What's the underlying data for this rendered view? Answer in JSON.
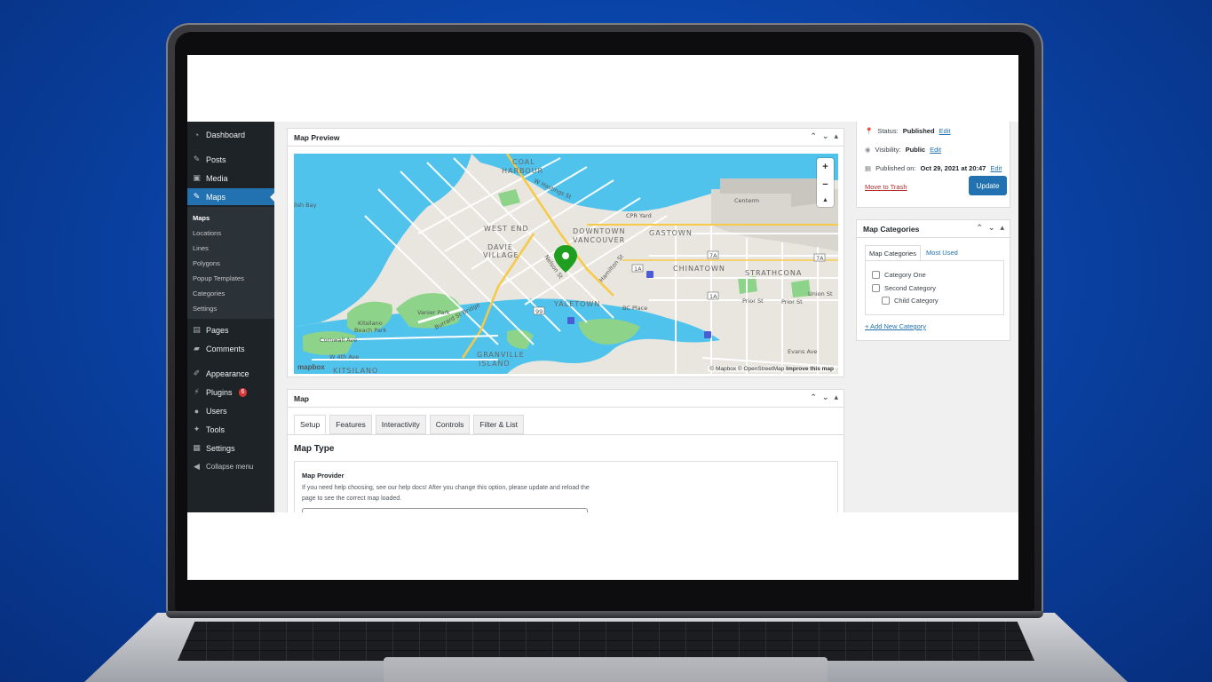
{
  "sidebar": {
    "items": [
      {
        "label": "Dashboard",
        "icon": "dashboard-icon"
      },
      {
        "label": "Posts",
        "icon": "pin-icon"
      },
      {
        "label": "Media",
        "icon": "media-icon"
      },
      {
        "label": "Maps",
        "icon": "pin-icon",
        "active": true
      },
      {
        "label": "Pages",
        "icon": "pages-icon"
      },
      {
        "label": "Comments",
        "icon": "comment-icon"
      },
      {
        "label": "Appearance",
        "icon": "brush-icon"
      },
      {
        "label": "Plugins",
        "icon": "plugin-icon",
        "badge": "6"
      },
      {
        "label": "Users",
        "icon": "user-icon"
      },
      {
        "label": "Tools",
        "icon": "wrench-icon"
      },
      {
        "label": "Settings",
        "icon": "settings-icon"
      },
      {
        "label": "Collapse menu",
        "icon": "collapse-icon"
      }
    ],
    "submenu": [
      "Maps",
      "Locations",
      "Lines",
      "Polygons",
      "Popup Templates",
      "Categories",
      "Settings"
    ]
  },
  "map_preview": {
    "title": "Map Preview",
    "zoom_in": "+",
    "zoom_out": "−",
    "compass": "▲",
    "attribution_a": "© Mapbox © OpenStreetMap",
    "attribution_b": "Improve this map",
    "logo": "mapbox",
    "labels": {
      "coal_harbour_1": "COAL",
      "coal_harbour_2": "HARBOUR",
      "west_end": "WEST END",
      "downtown_1": "DOWNTOWN",
      "downtown_2": "VANCOUVER",
      "gastown": "GASTOWN",
      "davie_1": "DAVIE",
      "davie_2": "VILLAGE",
      "chinatown": "CHINATOWN",
      "strathcona": "STRATHCONA",
      "yaletown": "YALETOWN",
      "granville_1": "GRANVILLE",
      "granville_2": "ISLAND",
      "kitsilano": "KITSILANO",
      "cpr_yard": "CPR Yard",
      "centerm": "Centerm",
      "bc_place": "BC Place",
      "vanier_park": "Vanier Park",
      "kits_beach_1": "Kitsilano",
      "kits_beach_2": "Beach Park",
      "english_bay": "lish Bay",
      "cornwall": "Cornwall Ave",
      "w4th": "W 4th Ave",
      "prior": "Prior St",
      "prior2": "Prior St",
      "union": "Union St",
      "evans": "Evans Ave",
      "w_hastings": "W Hastings St",
      "burrard_bridge": "Burrard St Bridge",
      "nelson": "Nelson St",
      "hamilton": "Hamilton St",
      "route_99": "99",
      "route_1a": "1A",
      "route_7a": "7A"
    }
  },
  "map_settings": {
    "title": "Map",
    "tabs": [
      "Setup",
      "Features",
      "Interactivity",
      "Controls",
      "Filter & List"
    ],
    "section_title": "Map Type",
    "provider_title": "Map Provider",
    "provider_help": "If you need help choosing, see our help docs! After you change this option, please update and reload the page to see the correct map loaded."
  },
  "publish": {
    "status_label": "Status:",
    "status_value": "Published",
    "visibility_label": "Visibility:",
    "visibility_value": "Public",
    "published_label": "Published on:",
    "published_value": "Oct 29, 2021 at 20:47",
    "edit": "Edit",
    "trash": "Move to Trash",
    "update": "Update"
  },
  "categories": {
    "title": "Map Categories",
    "tab_all": "Map Categories",
    "tab_used": "Most Used",
    "items": [
      "Category One",
      "Second Category",
      "Child Category"
    ],
    "add_new": "+ Add New Category"
  },
  "colors": {
    "wp_sidebar": "#1d2327",
    "wp_accent": "#2271b1",
    "water": "#4fc3ec",
    "park": "#8dd48a",
    "marker": "#1f9e1f",
    "background": "#0a44a8"
  }
}
